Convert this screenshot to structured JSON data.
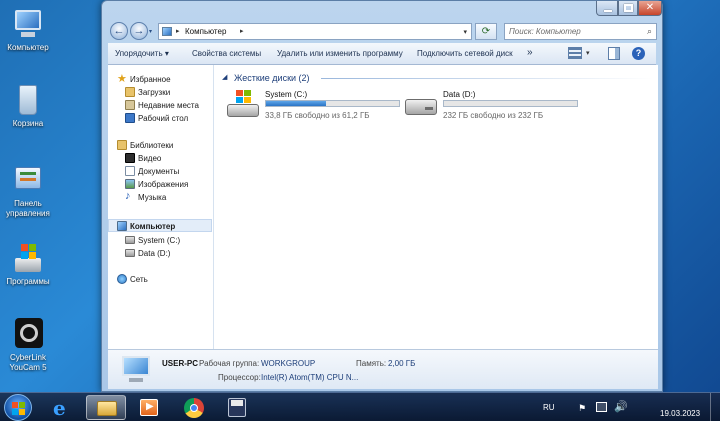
{
  "desktop": {
    "icons": [
      {
        "label": "Компьютер"
      },
      {
        "label": "Корзина"
      },
      {
        "label": "Панель управления"
      },
      {
        "label": "Программы"
      },
      {
        "label": "CyberLink YouCam 5"
      }
    ]
  },
  "window": {
    "address": {
      "crumb": "Компьютер"
    },
    "search": {
      "placeholder": "Поиск: Компьютер"
    },
    "toolbar": {
      "organize": "Упорядочить",
      "system_props": "Свойства системы",
      "uninstall": "Удалить или изменить программу",
      "map_drive": "Подключить сетевой диск",
      "more": "»"
    },
    "sidebar": {
      "favorites": "Избранное",
      "downloads": "Загрузки",
      "recent": "Недавние места",
      "desktop": "Рабочий стол",
      "libraries": "Библиотеки",
      "video": "Видео",
      "documents": "Документы",
      "images": "Изображения",
      "music": "Музыка",
      "computer": "Компьютер",
      "system_c": "System (C:)",
      "data_d": "Data (D:)",
      "network": "Сеть"
    },
    "section_title": "Жесткие диски (2)",
    "drives": [
      {
        "name": "System (C:)",
        "free": "33,8 ГБ свободно из 61,2 ГБ",
        "used_fraction": 0.448
      },
      {
        "name": "Data (D:)",
        "free": "232 ГБ свободно из 232 ГБ",
        "used_fraction": 0.0
      }
    ],
    "details": {
      "pc_name": "USER-PC",
      "workgroup_label": "Рабочая группа:",
      "workgroup_value": "WORKGROUP",
      "memory_label": "Память:",
      "memory_value": "2,00 ГБ",
      "cpu_label": "Процессор:",
      "cpu_value": "Intel(R) Atom(TM) CPU N..."
    }
  },
  "taskbar": {
    "lang": "RU",
    "date": "19.03.2023"
  }
}
